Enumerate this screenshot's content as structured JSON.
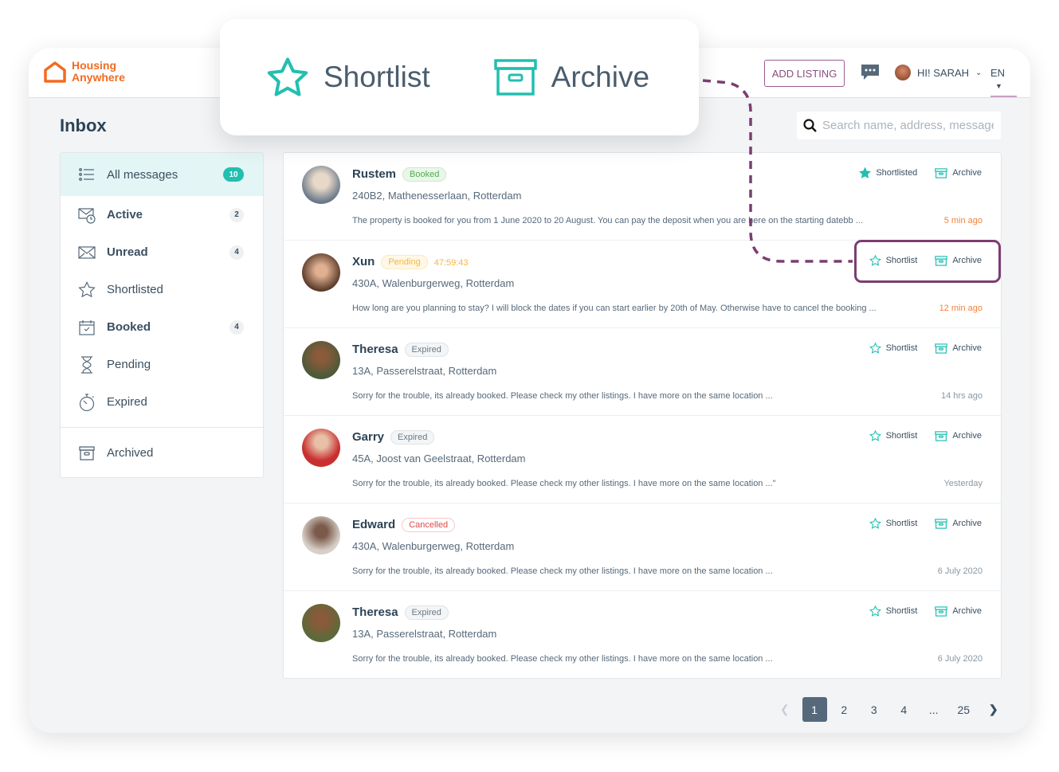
{
  "brand": {
    "line1": "Housing",
    "line2": "Anywhere",
    "color": "#f26b21"
  },
  "header": {
    "add_listing": "ADD LISTING",
    "greeting": "HI! SARAH",
    "language": "EN"
  },
  "inbox": {
    "title": "Inbox",
    "search_placeholder": "Search name, address, message"
  },
  "sidebar": {
    "items": [
      {
        "label": "All messages",
        "count": "10",
        "icon": "list-icon"
      },
      {
        "label": "Active",
        "count": "2",
        "icon": "mail-clock-icon"
      },
      {
        "label": "Unread",
        "count": "4",
        "icon": "envelope-icon"
      },
      {
        "label": "Shortlisted",
        "icon": "star-icon"
      },
      {
        "label": "Booked",
        "count": "4",
        "icon": "calendar-check-icon"
      },
      {
        "label": "Pending",
        "icon": "hourglass-icon"
      },
      {
        "label": "Expired",
        "icon": "stopwatch-icon"
      }
    ],
    "archived": "Archived"
  },
  "callout": {
    "shortlist": "Shortlist",
    "archive": "Archive",
    "accent": "#7a3e72"
  },
  "messages": [
    {
      "name": "Rustem",
      "status": "Booked",
      "address": "240B2, Mathenesserlaan, Rotterdam",
      "preview": "The property is booked for you from 1 June 2020 to 20 August. You can pay the deposit when you are here on the starting datebb ...",
      "time": "5 min ago",
      "shortlist": "Shortlisted",
      "archive": "Archive"
    },
    {
      "name": "Xun",
      "status": "Pending",
      "timer": "47:59:43",
      "address": "430A, Walenburgerweg, Rotterdam",
      "preview": "How long are you planning to stay? I will block the dates if you can start earlier by 20th of May. Otherwise have to cancel the booking ...",
      "time": "12 min ago",
      "shortlist": "Shortlist",
      "archive": "Archive"
    },
    {
      "name": "Theresa",
      "status": "Expired",
      "address": "13A, Passerelstraat, Rotterdam",
      "preview": "Sorry for the trouble, its already booked. Please check my other listings. I have more on the same location ...",
      "time": "14 hrs ago",
      "shortlist": "Shortlist",
      "archive": "Archive"
    },
    {
      "name": "Garry",
      "status": "Expired",
      "address": "45A, Joost van Geelstraat, Rotterdam",
      "preview": "Sorry for the trouble, its already booked. Please check my other listings. I have more on the same location ...\"",
      "time": "Yesterday",
      "shortlist": "Shortlist",
      "archive": "Archive"
    },
    {
      "name": "Edward",
      "status": "Cancelled",
      "address": "430A, Walenburgerweg, Rotterdam",
      "preview": "Sorry for the trouble, its already booked. Please check my other listings. I have more on the same location ...",
      "time": "6 July 2020",
      "shortlist": "Shortlist",
      "archive": "Archive"
    },
    {
      "name": "Theresa",
      "status": "Expired",
      "address": "13A, Passerelstraat, Rotterdam",
      "preview": "Sorry for the trouble, its already booked. Please check my other listings. I have more on the same location ...",
      "time": "6 July 2020",
      "shortlist": "Shortlist",
      "archive": "Archive"
    }
  ],
  "pagination": {
    "pages": [
      "1",
      "2",
      "3",
      "4",
      "...",
      "25"
    ],
    "current": "1"
  },
  "colors": {
    "teal": "#22bfb0",
    "booked": "#4caf50",
    "pending": "#f5b540",
    "cancelled": "#e04848",
    "expired": "#6b7a87"
  }
}
